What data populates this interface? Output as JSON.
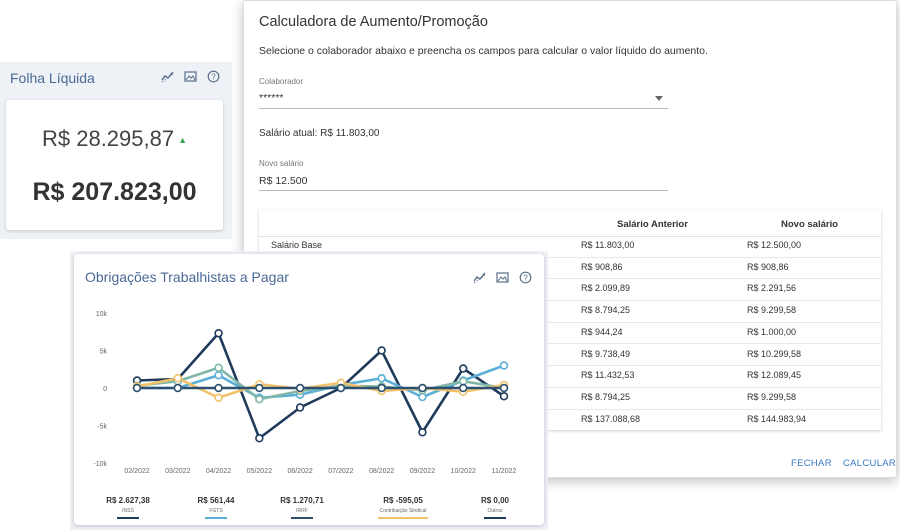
{
  "folha": {
    "title": "Folha Líquida",
    "value1": "R$ 28.295,87",
    "value2": "R$ 207.823,00",
    "icons": [
      "trend-icon",
      "image-icon",
      "help-icon"
    ]
  },
  "calculator": {
    "title": "Calculadora de Aumento/Promoção",
    "description": "Selecione o colaborador abaixo e preencha os campos para calcular o valor líquido do aumento.",
    "colaborador_label": "Colaborador",
    "colaborador_value": "******",
    "salario_atual": "Salário atual: R$ 11.803,00",
    "novo_salario_label": "Novo salário",
    "novo_salario_value": "R$ 12.500",
    "table": {
      "headers": [
        "",
        "Salário Anterior",
        "Novo salário"
      ],
      "rows": [
        {
          "label": "Salário Base",
          "anterior": "R$ 11.803,00",
          "novo": "R$ 12.500,00"
        },
        {
          "label": "",
          "anterior": "R$ 908,86",
          "novo": "R$ 908,86"
        },
        {
          "label": "",
          "anterior": "R$ 2.099,89",
          "novo": "R$ 2.291,56"
        },
        {
          "label": "",
          "anterior": "R$ 8.794,25",
          "novo": "R$ 9.299,58"
        },
        {
          "label": "",
          "anterior": "R$ 944,24",
          "novo": "R$ 1.000,00"
        },
        {
          "label": "",
          "anterior": "R$ 9.738,49",
          "novo": "R$ 10.299,58"
        },
        {
          "label": "",
          "anterior": "R$ 11.432,53",
          "novo": "R$ 12.089,45"
        },
        {
          "label": "",
          "anterior": "R$ 8.794,25",
          "novo": "R$ 9.299,58"
        },
        {
          "label": "",
          "anterior": "R$ 137.088,68",
          "novo": "R$ 144.983,94"
        }
      ]
    },
    "buttons": {
      "close": "FECHAR",
      "calculate": "CALCULAR"
    },
    "accent": "#3a78c2"
  },
  "obrigacoes": {
    "title": "Obrigações Trabalhistas a Pagar",
    "icons": [
      "trend-icon",
      "image-icon",
      "help-icon"
    ],
    "summary": [
      {
        "value": "R$ 2.627,38",
        "label": "INSS",
        "color": "#1f3a5a"
      },
      {
        "value": "R$ 561,44",
        "label": "FGTS",
        "color": "#5aaed6"
      },
      {
        "value": "R$ 1.270,71",
        "label": "IRRF",
        "color": "#2d5070"
      },
      {
        "value": "R$ -595,05",
        "label": "Contribuição Sindical",
        "color": "#f2c26b"
      },
      {
        "value": "R$ 0,00",
        "label": "Outros",
        "color": "#1f3a5a"
      }
    ]
  },
  "chart_data": {
    "type": "line",
    "x": [
      "02/2022",
      "03/2022",
      "04/2022",
      "05/2022",
      "06/2022",
      "07/2022",
      "08/2022",
      "09/2022",
      "10/2022",
      "11/2022"
    ],
    "yticks": [
      "10k",
      "5k",
      "0",
      "-5k",
      "-10k"
    ],
    "ylim": [
      -10000,
      10000
    ],
    "series": [
      {
        "color": "#1f3a5a",
        "values": [
          1000,
          1200,
          7300,
          -6700,
          -2600,
          0,
          5000,
          -5900,
          2600,
          -1100
        ]
      },
      {
        "color": "#5aaed6",
        "values": [
          0,
          0,
          1700,
          -1300,
          -900,
          400,
          1300,
          -1200,
          1000,
          3000
        ]
      },
      {
        "color": "#7fb8a8",
        "values": [
          300,
          900,
          2700,
          -1500,
          -400,
          300,
          200,
          -300,
          900,
          0
        ]
      },
      {
        "color": "#f2c26b",
        "values": [
          200,
          1300,
          -1300,
          500,
          -100,
          700,
          -400,
          0,
          -500,
          400
        ]
      },
      {
        "color": "#2d5070",
        "values": [
          0,
          0,
          0,
          0,
          0,
          0,
          0,
          0,
          0,
          0
        ]
      }
    ]
  }
}
